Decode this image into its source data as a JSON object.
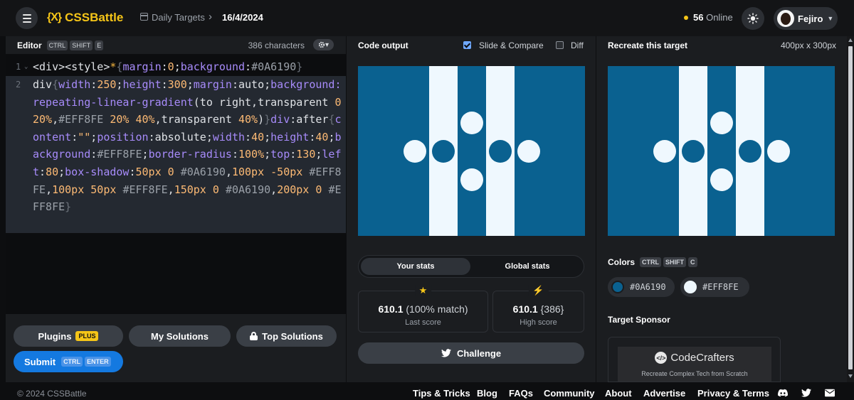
{
  "header": {
    "logo_mark": "{X}",
    "logo_text": "CSSBattle",
    "breadcrumb_section": "Daily Targets",
    "breadcrumb_sep": "›",
    "breadcrumb_date": "16/4/2024",
    "online_count": "56",
    "online_label": "Online",
    "user_name": "Fejiro",
    "accent_color": "#f5c518"
  },
  "editor": {
    "title": "Editor",
    "shortcut": [
      "CTRL",
      "SHIFT",
      "E"
    ],
    "char_count": "386 characters",
    "settings_caret": "▾",
    "line_numbers": [
      "1",
      "2"
    ],
    "fold_marker": "⌄",
    "code_line_1": "<div><style>*{margin:0;background:#0A6190}",
    "code_line_2": "div{width:250;height:300;margin:auto;background:repeating-linear-gradient(to right,transparent 0 20%,#EFF8FE 20% 40%,transparent 40%)}div:after{content:\"\";position:absolute;width:40;height:40;background:#EFF8FE;border-radius:100%;top:130;left:80;box-shadow:50px 0 #0A6190,100px -50px #EFF8FE,100px 50px #EFF8FE,150px 0 #0A6190,200px 0 #EFF8FE}",
    "plugins_label": "Plugins",
    "plugins_badge": "PLUS",
    "my_solutions_label": "My Solutions",
    "top_solutions_label": "Top Solutions",
    "submit_label": "Submit",
    "submit_shortcut": [
      "CTRL",
      "ENTER"
    ]
  },
  "output": {
    "title": "Code output",
    "slide_compare_label": "Slide & Compare",
    "slide_compare_checked": true,
    "diff_label": "Diff",
    "diff_checked": false,
    "tab_your_stats": "Your stats",
    "tab_global_stats": "Global stats",
    "last_score_value": "610.1",
    "last_score_match": "(100% match)",
    "last_score_label": "Last score",
    "high_score_value": "610.1",
    "high_score_chars": "{386}",
    "high_score_label": "High score",
    "challenge_label": "Challenge"
  },
  "target": {
    "title": "Recreate this target",
    "size": "400px x 300px",
    "colors_title": "Colors",
    "colors_shortcut": [
      "CTRL",
      "SHIFT",
      "C"
    ],
    "colors": [
      "#0A6190",
      "#EFF8FE"
    ],
    "sponsor_title": "Target Sponsor",
    "sponsor_name": "CodeCrafters",
    "sponsor_tagline": "Recreate Complex Tech from Scratch"
  },
  "footer": {
    "copyright": "© 2024 CSSBattle",
    "links": [
      "Tips & Tricks",
      "Blog",
      "FAQs",
      "Community",
      "About",
      "Advertise",
      "Privacy & Terms"
    ]
  }
}
